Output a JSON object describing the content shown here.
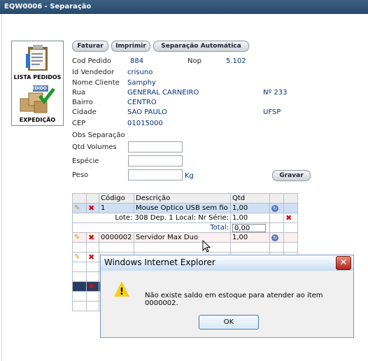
{
  "window": {
    "title": "EQW0006 - Separação"
  },
  "sidebar": {
    "lista_label": "LISTA PEDIDOS",
    "expedicao_label": "EXPEDIÇÃO",
    "pedido_tag": "PEDIDO"
  },
  "toolbar": {
    "faturar": "Faturar",
    "imprimir": "Imprimir",
    "separacao_auto": "Separação Automática"
  },
  "order": {
    "cod_pedido_label": "Cod Pedido",
    "cod_pedido": "884",
    "nop_label": "Nop",
    "nop": "5.102",
    "vendedor_label": "Id Vendedor",
    "vendedor": "crisuno",
    "cliente_label": "Nome Cliente",
    "cliente": "Samphy",
    "rua_label": "Rua",
    "rua": "GENERAL CARNEIRO",
    "numero": "Nº 233",
    "bairro_label": "Bairro",
    "bairro": "CENTRO",
    "cidade_label": "Cidade",
    "cidade": "SAO PAULO",
    "uf": "UFSP",
    "cep_label": "CEP",
    "cep": "01015000",
    "obs_label": "Obs Separação",
    "volumes_label": "Qtd Volumes",
    "especie_label": "Espécie",
    "peso_label": "Peso",
    "peso_unit": "Kg",
    "gravar": "Gravar"
  },
  "table": {
    "headers": {
      "codigo": "Código",
      "descricao": "Descrição",
      "qtd": "Qtd"
    },
    "row1": {
      "codigo": "1",
      "descricao": "Mouse Optico USB sem fio",
      "qtd": "1,00"
    },
    "lote": {
      "label": "Lote: 308 Dep. 1 Local: Nr Série:",
      "qtd": "1,00"
    },
    "total": {
      "label": "Total:",
      "value": "0,00"
    },
    "row2": {
      "codigo": "0000002",
      "descricao": "Servidor Max Duo",
      "qtd": "1,00"
    }
  },
  "dialog": {
    "title": "Windows Internet Explorer",
    "message": "Não existe saldo em estoque para atender ao item 0000002.",
    "ok": "OK"
  }
}
